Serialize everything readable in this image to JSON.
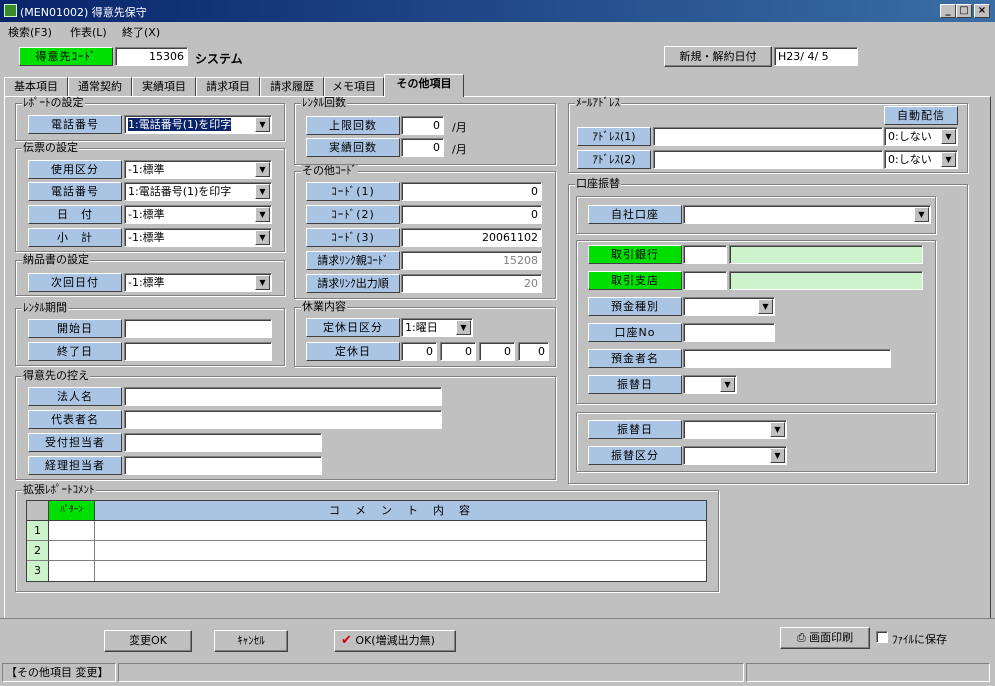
{
  "window": {
    "title": "(MEN01002) 得意先保守",
    "minimize": "_",
    "maximize": "□",
    "close": "×"
  },
  "menu": [
    "検索(F3)",
    "作表(L)",
    "終了(X)"
  ],
  "header": {
    "code_label": "得意先ｺｰﾄﾞ",
    "code_value": "15306",
    "name": "システム",
    "date_label": "新規・解約日付",
    "date_value": "H23/ 4/ 5"
  },
  "tabs": [
    "基本項目",
    "通常契約",
    "実績項目",
    "請求項目",
    "請求履歴",
    "メモ項目",
    "その他項目"
  ],
  "report": {
    "title": "ﾚﾎﾟｰﾄの設定",
    "phone_label": "電話番号",
    "phone_value": "1:電話番号(1)を印字"
  },
  "slip": {
    "title": "伝票の設定",
    "rows": [
      {
        "label": "使用区分",
        "value": "-1:標準"
      },
      {
        "label": "電話番号",
        "value": "1:電話番号(1)を印字"
      },
      {
        "label": "日　付",
        "value": "-1:標準"
      },
      {
        "label": "小　計",
        "value": "-1:標準"
      }
    ]
  },
  "delivery": {
    "title": "納品書の設定",
    "label": "次回日付",
    "value": "-1:標準"
  },
  "rental_period": {
    "title": "ﾚﾝﾀﾙ期間",
    "start_label": "開始日",
    "start_value": "",
    "end_label": "終了日",
    "end_value": ""
  },
  "rental_count": {
    "title": "ﾚﾝﾀﾙ回数",
    "max_label": "上限回数",
    "max_value": "0",
    "actual_label": "実績回数",
    "actual_value": "0",
    "unit": "/月"
  },
  "other_code": {
    "title": "その他ｺｰﾄﾞ",
    "rows": [
      {
        "label": "ｺｰﾄﾞ(1)",
        "value": "0"
      },
      {
        "label": "ｺｰﾄﾞ(2)",
        "value": "0"
      },
      {
        "label": "ｺｰﾄﾞ(3)",
        "value": "20061102"
      },
      {
        "label": "請求ﾘﾝｸ親ｺｰﾄﾞ",
        "value": "15208"
      },
      {
        "label": "請求ﾘﾝｸ出力順",
        "value": "20"
      }
    ]
  },
  "holiday": {
    "title": "休業内容",
    "type_label": "定休日区分",
    "type_value": "1:曜日",
    "day_label": "定休日",
    "days": [
      "0",
      "0",
      "0",
      "0"
    ]
  },
  "customer": {
    "title": "得意先の控え",
    "rows": [
      {
        "label": "法人名",
        "value": ""
      },
      {
        "label": "代表者名",
        "value": ""
      },
      {
        "label": "受付担当者",
        "value": ""
      },
      {
        "label": "経理担当者",
        "value": ""
      }
    ]
  },
  "mail": {
    "title": "ﾒｰﾙｱﾄﾞﾚｽ",
    "auto_button": "自動配信",
    "rows": [
      {
        "label": "ｱﾄﾞﾚｽ(1)",
        "value": "",
        "option": "0:しない"
      },
      {
        "label": "ｱﾄﾞﾚｽ(2)",
        "value": "",
        "option": "0:しない"
      }
    ]
  },
  "bank": {
    "title": "口座振替",
    "own_label": "自社口座",
    "own_value": "",
    "bank_label": "取引銀行",
    "branch_label": "取引支店",
    "type_label": "預金種別",
    "no_label": "口座No",
    "holder_label": "預金者名",
    "transfer_day_label": "振替日",
    "transfer_day2_label": "振替日",
    "transfer_kind_label": "振替区分"
  },
  "comment": {
    "title": "拡張ﾚﾎﾟｰﾄｺﾒﾝﾄ",
    "col1": "ﾊﾟﾀｰﾝ",
    "col2": "コ　メ　ン　ト　内　容",
    "rows": [
      "1",
      "2",
      "3"
    ]
  },
  "footer": {
    "ok": "変更OK",
    "cancel": "ｷｬﾝｾﾙ",
    "ok_no_output": "OK(増減出力無)",
    "print": "画面印刷",
    "save_file": "ﾌｧｲﾙに保存"
  },
  "status": {
    "text": "【その他項目 変更】"
  }
}
